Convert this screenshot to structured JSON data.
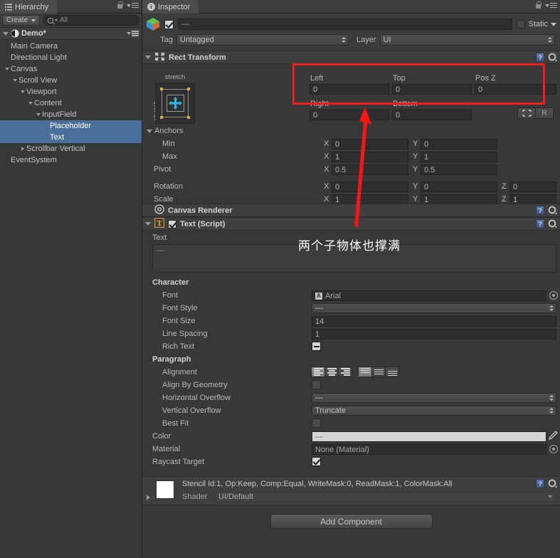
{
  "hierarchy": {
    "tab_label": "Hierarchy",
    "create_label": "Create",
    "search_placeholder": "All",
    "scene_name": "Demo*",
    "items": [
      {
        "label": "Main Camera",
        "depth": 1,
        "arrow": "none",
        "selected": false
      },
      {
        "label": "Directional Light",
        "depth": 1,
        "arrow": "none",
        "selected": false
      },
      {
        "label": "Canvas",
        "depth": 1,
        "arrow": "down",
        "selected": false
      },
      {
        "label": "Scroll View",
        "depth": 2,
        "arrow": "down",
        "selected": false
      },
      {
        "label": "Viewport",
        "depth": 3,
        "arrow": "down",
        "selected": false
      },
      {
        "label": "Content",
        "depth": 4,
        "arrow": "down",
        "selected": false
      },
      {
        "label": "InputField",
        "depth": 5,
        "arrow": "down",
        "selected": false
      },
      {
        "label": "Placeholder",
        "depth": 6,
        "arrow": "none",
        "selected": true
      },
      {
        "label": "Text",
        "depth": 6,
        "arrow": "none",
        "selected": true
      },
      {
        "label": "Scrollbar Vertical",
        "depth": 3,
        "arrow": "right",
        "selected": false
      },
      {
        "label": "EventSystem",
        "depth": 1,
        "arrow": "none",
        "selected": false
      }
    ]
  },
  "inspector": {
    "tab_label": "Inspector",
    "object_name": "—",
    "static_label": "Static",
    "tag_label": "Tag",
    "tag_value": "Untagged",
    "layer_label": "Layer",
    "layer_value": "UI",
    "rect_transform": {
      "title": "Rect Transform",
      "h_stretch_label": "stretch",
      "v_stretch_label": "stretch",
      "left_label": "Left",
      "left_value": "0",
      "top_label": "Top",
      "top_value": "0",
      "posz_label": "Pos Z",
      "posz_value": "0",
      "right_label": "Right",
      "right_value": "0",
      "bottom_label": "Bottom",
      "bottom_value": "0",
      "anchors_label": "Anchors",
      "min_label": "Min",
      "min_x": "0",
      "min_y": "0",
      "max_label": "Max",
      "max_x": "1",
      "max_y": "1",
      "pivot_label": "Pivot",
      "pivot_x": "0.5",
      "pivot_y": "0.5",
      "rotation_label": "Rotation",
      "rot_x": "0",
      "rot_y": "0",
      "rot_z": "0",
      "scale_label": "Scale",
      "scale_x": "1",
      "scale_y": "1",
      "scale_z": "1",
      "axis_x": "X",
      "axis_y": "Y",
      "axis_z": "Z"
    },
    "canvas_renderer": {
      "title": "Canvas Renderer"
    },
    "text_script": {
      "title": "Text (Script)",
      "text_label": "Text",
      "text_value": "—",
      "character_label": "Character",
      "font_label": "Font",
      "font_value": "Arial",
      "font_style_label": "Font Style",
      "font_style_value": "—",
      "font_size_label": "Font Size",
      "font_size_value": "14",
      "line_spacing_label": "Line Spacing",
      "line_spacing_value": "1",
      "rich_text_label": "Rich Text",
      "paragraph_label": "Paragraph",
      "alignment_label": "Alignment",
      "align_by_geometry_label": "Align By Geometry",
      "horizontal_overflow_label": "Horizontal Overflow",
      "horizontal_overflow_value": "—",
      "vertical_overflow_label": "Vertical Overflow",
      "vertical_overflow_value": "Truncate",
      "best_fit_label": "Best Fit",
      "color_label": "Color",
      "color_value": "—",
      "color_hex": "#d5d5d5",
      "material_label": "Material",
      "material_value": "None (Material)",
      "raycast_target_label": "Raycast Target"
    },
    "material_block": {
      "stencil_line": "Stencil Id:1, Op:Keep, Comp:Equal, WriteMask:0, ReadMask:1, ColorMask:All",
      "shader_label": "Shader",
      "shader_value": "UI/Default"
    },
    "add_component_label": "Add Component"
  },
  "annotations": {
    "note_text": "两个子物体也撑满",
    "highlight_color": "#f01d1d"
  }
}
